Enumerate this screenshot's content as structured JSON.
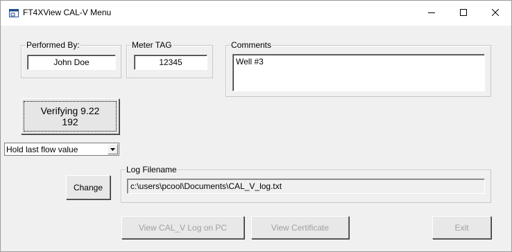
{
  "window": {
    "title": "FT4XView CAL-V Menu",
    "controls": {
      "minimize_icon": "minimize-icon",
      "maximize_icon": "maximize-icon",
      "close_icon": "close-icon"
    }
  },
  "performed_by": {
    "legend": "Performed By:",
    "value": "John Doe"
  },
  "meter_tag": {
    "legend": "Meter TAG",
    "value": "12345"
  },
  "comments": {
    "legend": "Comments",
    "value": "Well #3"
  },
  "verify_button": {
    "line1": "Verifying  9.22",
    "line2": "192"
  },
  "flow_select": {
    "selected": "Hold last flow value"
  },
  "change_button": {
    "label": "Change"
  },
  "log_filename": {
    "legend": "Log Filename",
    "value": "c:\\users\\pcool\\Documents\\CAL_V_log.txt"
  },
  "footer": {
    "view_log_label": "View CAL_V Log on PC",
    "view_cert_label": "View Certificate",
    "exit_label": "Exit"
  },
  "colors": {
    "window_bg": "#f0f0f0",
    "titlebar_bg": "#ffffff",
    "disabled_text": "#a0a0a0"
  }
}
